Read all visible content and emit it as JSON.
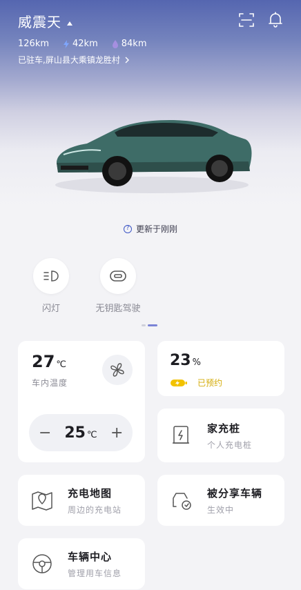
{
  "header": {
    "title": "威震天",
    "range_total": "126km",
    "range_electric": "42km",
    "range_fuel": "84km",
    "location": "已驻车,屏山县大乘镇龙胜村",
    "icons": [
      "scan-icon",
      "bell-icon"
    ]
  },
  "vehicle": {
    "update_status": "更新于刚刚"
  },
  "quick_actions": [
    {
      "label": "闪灯",
      "icon": "headlight-icon"
    },
    {
      "label": "无钥匙驾驶",
      "icon": "keyless-icon"
    }
  ],
  "climate": {
    "interior_temp": "27",
    "interior_label": "车内温度",
    "unit": "℃",
    "set_temp": "25",
    "minus": "−",
    "plus": "+"
  },
  "battery": {
    "percent": "23",
    "percent_sign": "%",
    "status": "已预约",
    "accent": "#f2c200"
  },
  "tiles": {
    "charger": {
      "title": "家充桩",
      "subtitle": "个人充电桩"
    },
    "charge_map": {
      "title": "充电地图",
      "subtitle": "周边的充电站"
    },
    "shared": {
      "title": "被分享车辆",
      "subtitle": "生效中"
    },
    "vehicle_center": {
      "title": "车辆中心",
      "subtitle": "管理用车信息"
    }
  }
}
